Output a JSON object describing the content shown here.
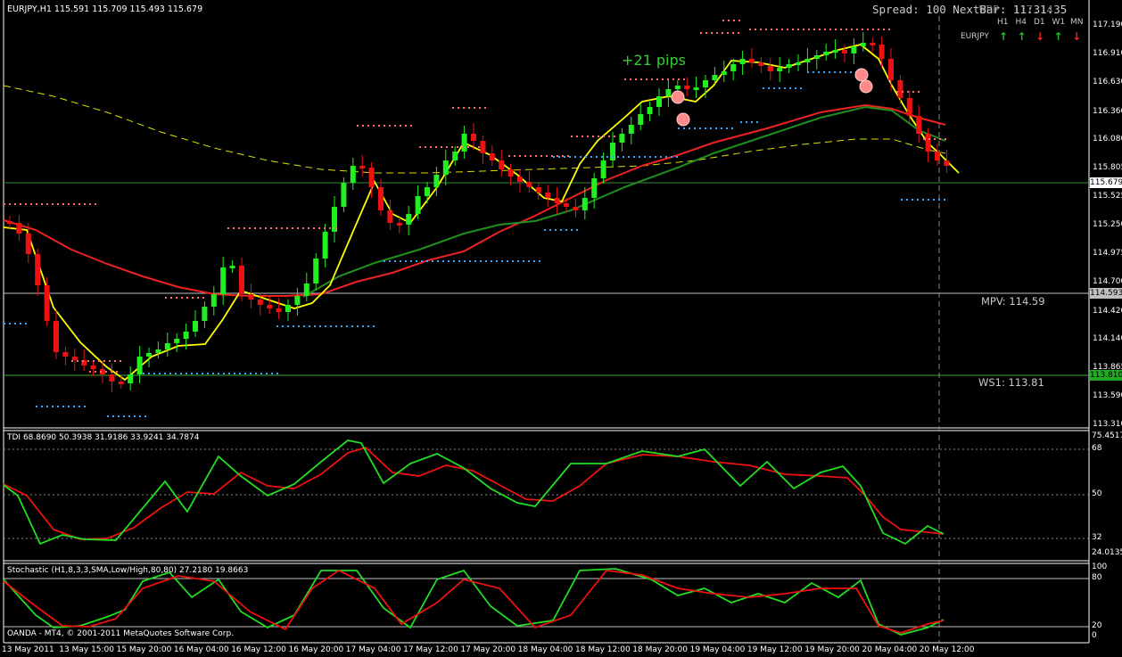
{
  "window": {
    "symbol_header": "EURJPY,H1  115.591 115.709 115.493 115.679",
    "spread_text": "Spread: 100 NextBar: 11:31:35",
    "wpp_label": "WPP: 117.14",
    "annotation": "+21 pips",
    "copyright": "OANDA - MT4, © 2001-2011 MetaQuotes Software Corp."
  },
  "trend_panel": {
    "symbol": "EURJPY",
    "timeframes": [
      "H1",
      "H4",
      "D1",
      "W1",
      "MN"
    ],
    "directions": [
      "up",
      "up",
      "down",
      "up",
      "down"
    ],
    "up_color": "#20c020",
    "down_color": "#ff2020"
  },
  "price_axis": {
    "ticks": [
      "117.190",
      "116.910",
      "116.630",
      "116.360",
      "116.080",
      "115.805",
      "115.525",
      "115.250",
      "114.975",
      "114.700",
      "114.420",
      "114.140",
      "113.865",
      "113.590",
      "113.310"
    ],
    "current_price": "115.679",
    "mpv_badge": "114.593",
    "ws1_badge": "113.810"
  },
  "levels": {
    "mpv_label": "MPV:  114.59",
    "ws1_label": "WS1:  113.81"
  },
  "tdi": {
    "header": "TDI 68.8690 50.3938 31.9186 33.9241 34.7874",
    "ticks": [
      "75.4517",
      "68",
      "50",
      "32",
      "24.0135"
    ]
  },
  "stochastic": {
    "header": "Stochastic (H1,8,3,3,SMA,Low/High,80,80) 27.2180 19.8663",
    "ticks": [
      "100",
      "80",
      "20",
      "0"
    ]
  },
  "time_axis": [
    "13 May 2011",
    "13 May 15:00",
    "15 May 20:00",
    "16 May 04:00",
    "16 May 12:00",
    "16 May 20:00",
    "17 May 04:00",
    "17 May 12:00",
    "17 May 20:00",
    "18 May 04:00",
    "18 May 12:00",
    "18 May 20:00",
    "19 May 04:00",
    "19 May 12:00",
    "19 May 20:00",
    "20 May 04:00",
    "20 May 12:00"
  ],
  "colors": {
    "bull": "#22ee22",
    "bear": "#ee1111",
    "ema_fast": "#ffff00",
    "ema_red": "#ee2222",
    "ema_green": "#1f8f1f",
    "sma_dashed": "#e0e000",
    "resistance_dots": "#ff6a6a",
    "support_dots": "#33a8ff",
    "tdi_green": "#22dd22",
    "tdi_red": "#ee1111"
  }
}
